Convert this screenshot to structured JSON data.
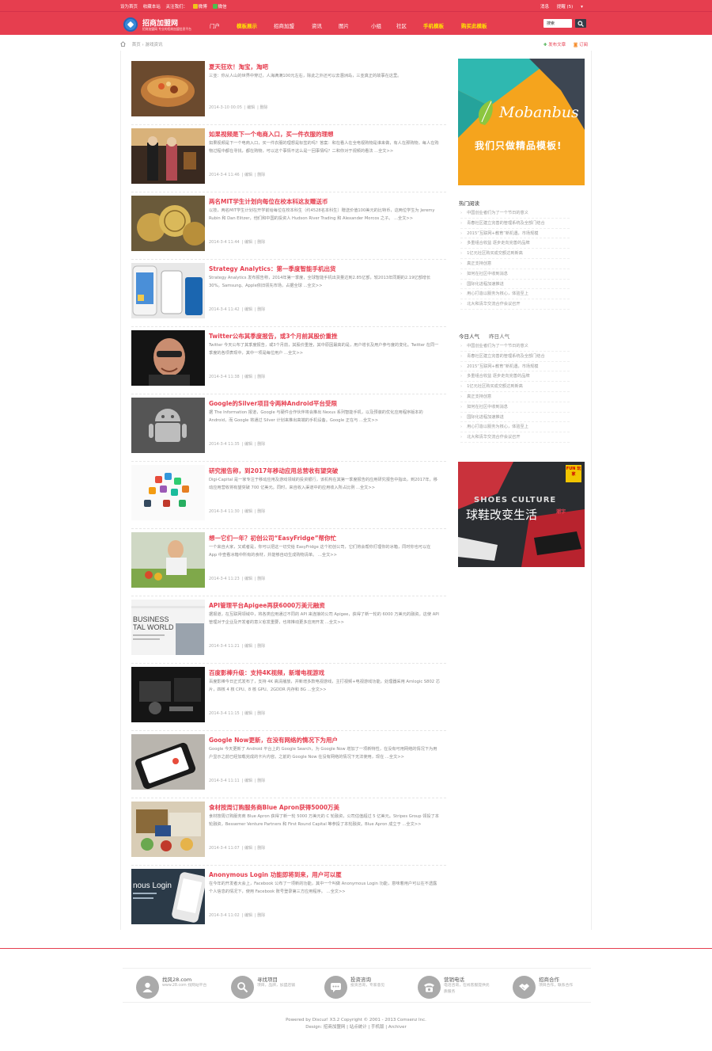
{
  "topbar": {
    "left": [
      "设为首页",
      "收藏本站",
      "关注我们：",
      "微博",
      "微信"
    ],
    "right": [
      "消息",
      "提醒 (5)"
    ]
  },
  "logo": {
    "title": "招商加盟网",
    "subtitle": "招商加盟网 专业的招商加盟信息平台"
  },
  "nav": {
    "items": [
      "门户",
      "模板展示",
      "招商加盟",
      "资讯",
      "图片",
      "小组",
      "社区",
      "手机模板",
      "购买此模板"
    ],
    "search_placeholder": "搜索"
  },
  "breadcrumb": {
    "home": "首页",
    "current": "游戏资讯",
    "post_label": "发布文章",
    "subscribe_label": "订阅"
  },
  "articles": [
    {
      "title": "夏天狂欢！淘宝，淘吧",
      "summary": "三亚：你从人山的世界中穿过，人海满满100元左右，除此之外还可以去涠洲岛，三亚真正的故事在这里。",
      "date": "2014-3-10 00:05",
      "edit": "编辑",
      "del": "删除"
    },
    {
      "title": "如果视频是下一个电商入口，买一件衣服的理想",
      "summary": "如果视频是下一个电商入口，买一件衣服的理想是标签的吗？答案：和在看人在全电视购物是谁来做，有人在那购物，每人在购物过程中都在寻找，都在购物，可以这个事情不这么是一回事情吗？二和你对于视频的看法 ...全文>>",
      "date": "2014-3-4 11:46",
      "edit": "编辑",
      "del": "删除"
    },
    {
      "title": "两名MIT学生计划向每位在校本科这友赠送币",
      "summary": "以技，两名MIT学生计划在开学前给每位在校本科生（约4528名本科生）赠送价值100美元的比特币，这两位学生为 Jeremy Rubin 和 Dan Elitzer，他们和中国的投资人 Hudson River Trading 和 Alexander Morcos 之子。 ...全文>>",
      "date": "2014-3-4 11:44",
      "edit": "编辑",
      "del": "删除"
    },
    {
      "title": "Strategy Analytics：第一季度智能手机出货",
      "summary": "Strategy Analytics 发布报告称，2014年第一季度，全球智能手机出货量达到2.85亿部，较2013年同期的2.19亿部增长30%。Samsung、Apple依旧领先市场，占据全球 ...全文>>",
      "date": "2014-3-4 11:42",
      "edit": "编辑",
      "del": "删除"
    },
    {
      "title": "Twitter公布其季度报告，或3个月前其股价重挫",
      "summary": "Twitter 今天公布了其季度报告，或3个月前，其股价重挫，其中原因最高的是，用户增长及用户参与度的变化。Twitter 在同一季度的各项表现中，其中一项是每位用户 ...全文>>",
      "date": "2014-3-4 11:38",
      "edit": "编辑",
      "del": "删除"
    },
    {
      "title": "Google的Silver项目令两种Android平台受限",
      "summary": "据 The Information 报道，Google 与硬件合作伙伴将会推出 Nexus 系列智能手机，以及预装的优化应用程序版本的Android，而 Google 将通过 Silver 计划来推出高端的手机设备。Google 正在与 ...全文>>",
      "date": "2014-3-4 11:35",
      "edit": "编辑",
      "del": "删除"
    },
    {
      "title": "研究报告称，到2017年移动应用总营收有望突破",
      "summary": "Digi-Capital 是一家专注于移动应用及游戏领域的投资银行，该机构在其第一季度报告的应用研究报告中指出，到2017年，移动应用营收将有望突破 700 亿美元。同时，来自收入渠道中的应用收入所占比例 ...全文>>",
      "date": "2014-3-4 11:30",
      "edit": "编辑",
      "del": "删除"
    },
    {
      "title": "想一它们一年？初创公司“EasyFridge”帮你忙",
      "summary": "一个来自大家，又或者是，你可以把这一切交给 EasyFridge 这个初创公司，它们将会帮你打理你的冰箱，同时你也可以在 App 中查看冰箱中所有的食材，并能够自动生成购物清单。 ...全文>>",
      "date": "2014-3-4 11:23",
      "edit": "编辑",
      "del": "删除"
    },
    {
      "title": "API管理平台Apigee再获6000万美元融资",
      "summary": "据报道，在互联网领域中，将各类应用通过不同的 API 来连接的公司 Apigee，获得了新一轮的 6000 万美元的融资。这使 API 管理对于企业及开发者的意义愈发重要，也将推动更多应用开发 ...全文>>",
      "date": "2014-3-4 11:21",
      "edit": "编辑",
      "del": "删除"
    },
    {
      "title": "百度影棒升级：支持4K视频，新增电视游戏",
      "summary": "百度影棒今日正式发布了，支持 4K 高清播放，并新增多款电视游戏，主打视频+电视游戏功能，处理器采用 Amlogic S802 芯片，四核 4 核 CPU、8 核 GPU、2GDDR 内存和 8G ...全文>>",
      "date": "2014-3-4 11:15",
      "edit": "编辑",
      "del": "删除"
    },
    {
      "title": "Google Now更新，在没有网络的情况下为用户",
      "summary": "Google 今天更新了 Android 平台上的 Google Search，为 Google Now 增加了一项新特性，在没有可用网络的情况下为用户显示之前已经加载完成的卡片内容。之前的 Google Now 在没有网络的情况下无法使用，现在 ...全文>>",
      "date": "2014-3-4 11:11",
      "edit": "编辑",
      "del": "删除"
    },
    {
      "title": "食材按周订购服务商Blue Apron获得5000万美",
      "summary": "食材按周订购服务商 Blue Apron 获得了新一轮 5000 万美元的 C 轮融资，公司估值超过 5 亿美元。Stripes Group 领投了本轮融资，Bessemer Venture Partners 和 First Round Capital 等参投了本轮融资。Blue Apron 成立于 ...全文>>",
      "date": "2014-3-4 11:07",
      "edit": "编辑",
      "del": "删除"
    },
    {
      "title": "Anonymous Login 功能即将到来，用户可以匿",
      "summary": "在今年的开发者大会上，Facebook 公布了一项新的功能，其中一个叫做 Anonymous Login 功能，意味着用户可以在不透露个人信息的情况下，使用 Facebook 账号登录第三方应用程序。 ...全文>>",
      "date": "2014-3-4 11:02",
      "edit": "编辑",
      "del": "删除"
    }
  ],
  "banner": {
    "brand": "Mobanbus",
    "slogan": "我们只做精品模板!"
  },
  "hot": {
    "title": "热门阅读",
    "items": [
      "中国创业者们为了一个节日的意义",
      "青春社区建立完善的管理系统及全部门结合",
      "2015“互联网+教育”新机遇，市场规模",
      "多重组合收益 逐步走向完善的品牌",
      "1亿元社区购买成交额达到新高",
      "真正支持创意",
      "如何在社区中收到消息",
      "国际化进程加速推进",
      "用心打造以服务为核心，体验至上",
      "北大和清华交流合作会议召开"
    ]
  },
  "popular": {
    "tabs": [
      "今日人气",
      "昨日人气"
    ],
    "items": [
      "中国创业者们为了一个节日的意义",
      "青春社区建立完善的管理系统及全部门结合",
      "2015“互联网+教育”新机遇，市场规模",
      "多重组合收益 逐步走向完善的品牌",
      "1亿元社区购买成交额达到新高",
      "真正支持创意",
      "如何在社区中收到消息",
      "国际化进程加速推进",
      "用心打造以服务为核心，体验至上",
      "北大和清华交流合作会议召开"
    ]
  },
  "shoe_ad": {
    "line1": "SHOES CULTURE",
    "line2": "球鞋改变生活",
    "badge": "FUN 玩家",
    "side": "潮字"
  },
  "footer": {
    "items": [
      {
        "h": "找风28.com",
        "d": "www.28.com 找网站平台"
      },
      {
        "h": "寻找项目",
        "d": "项目，品牌，加盟店铺"
      },
      {
        "h": "投资咨询",
        "d": "投资咨询，专家意见"
      },
      {
        "h": "营销电话",
        "d": "电话咨询，在线客服提供优质服务"
      },
      {
        "h": "招商合作",
        "d": "项目合作，联系合作"
      }
    ],
    "copyright": "Powered by Discuz! X3.2 Copyright © 2001 - 2013 Comsenz Inc.",
    "design": "Design: 招商加盟网 | 站点统计 | 手机版 | Archiver"
  }
}
